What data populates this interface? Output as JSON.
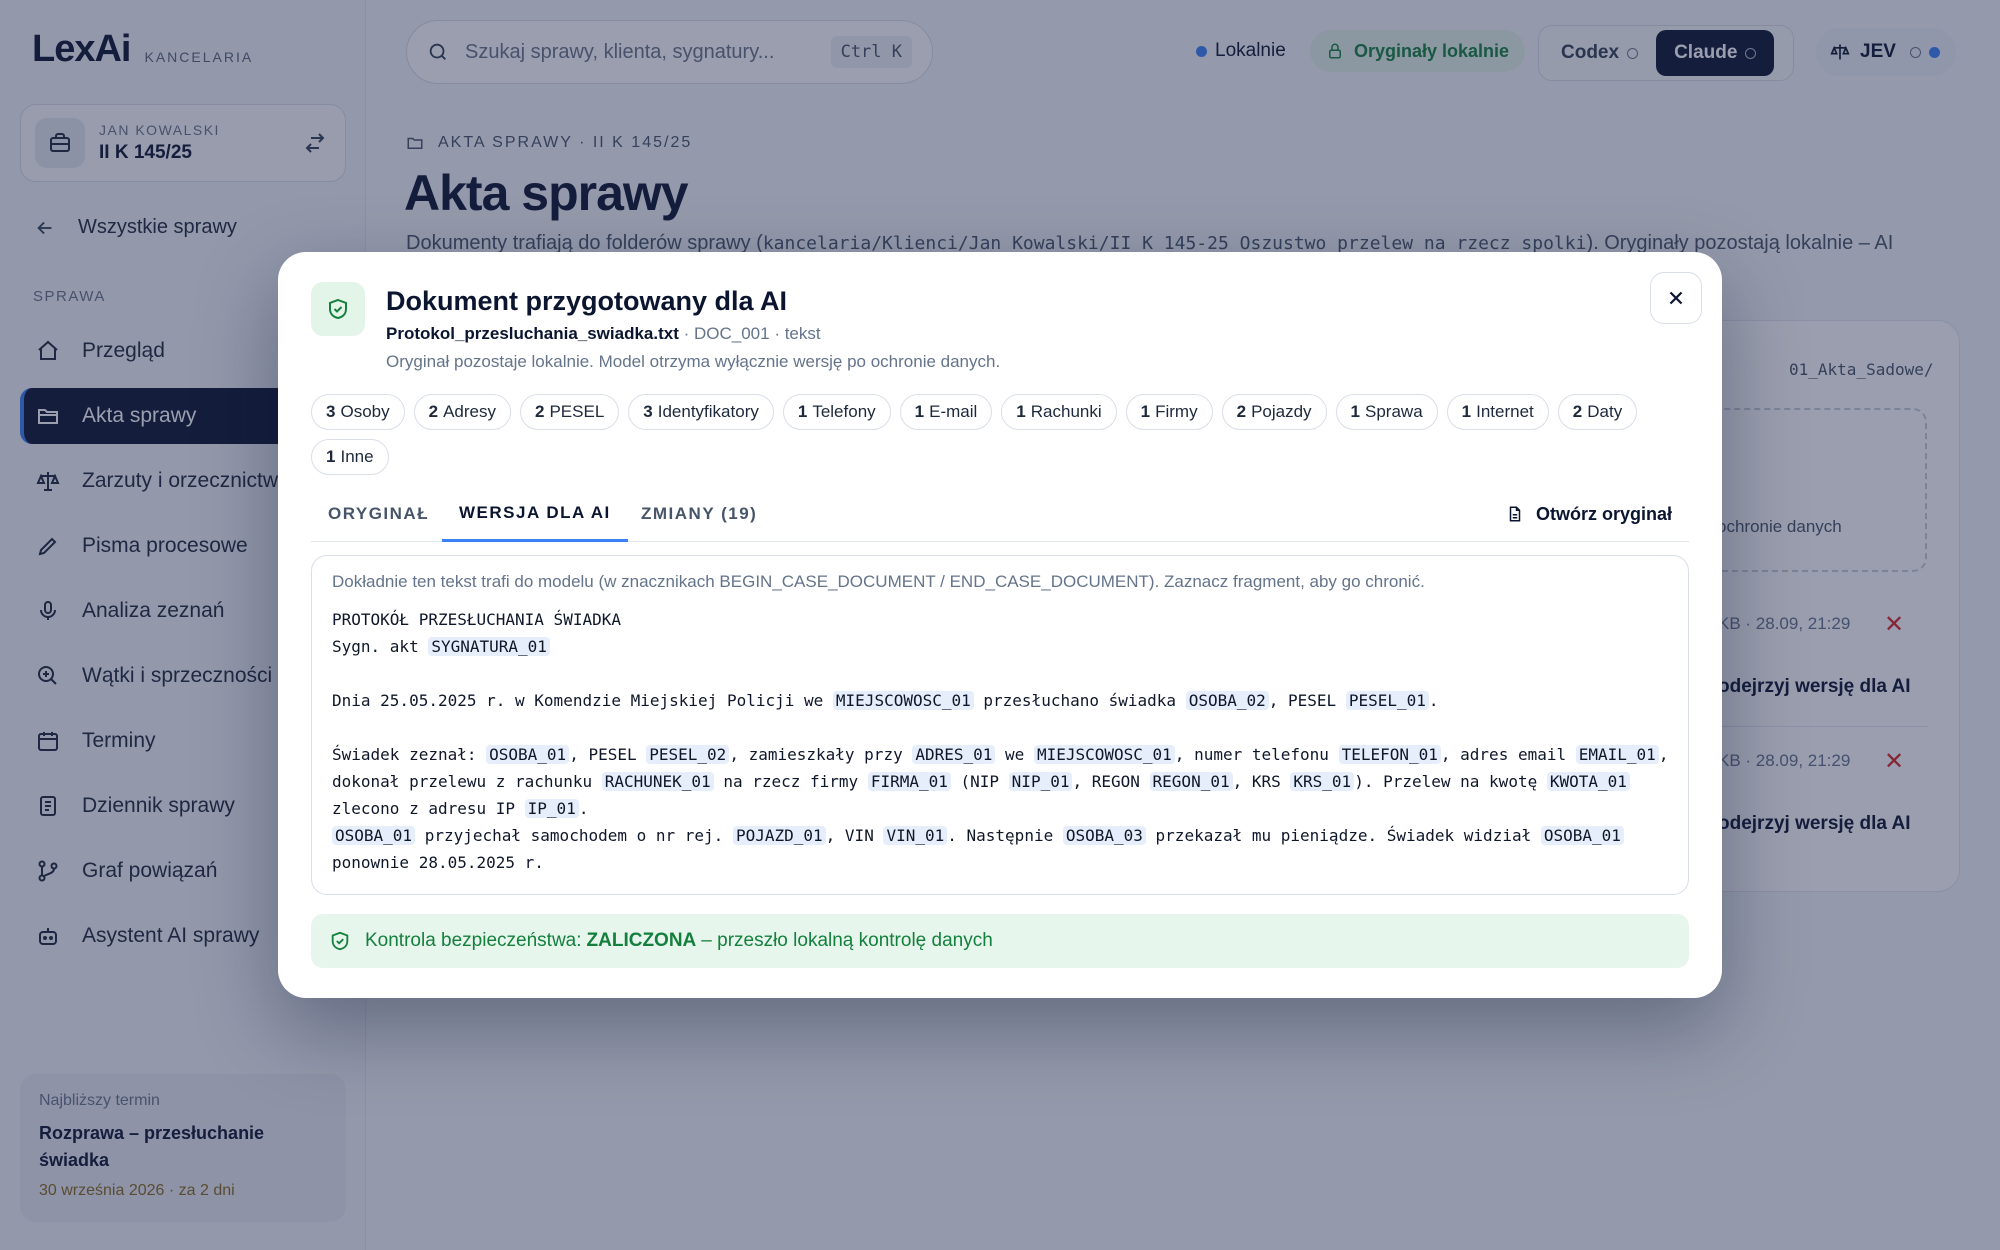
{
  "brand": {
    "logo": "LexAi",
    "subtitle": "KANCELARIA"
  },
  "case_card": {
    "client": "JAN KOWALSKI",
    "signature": "II K 145/25"
  },
  "back_link": "Wszystkie sprawy",
  "sidebar": {
    "section": "SPRAWA",
    "items": [
      {
        "label": "Przegląd",
        "icon": "home-icon"
      },
      {
        "label": "Akta sprawy",
        "icon": "folder-icon"
      },
      {
        "label": "Zarzuty i orzecznictwo",
        "icon": "scales-icon"
      },
      {
        "label": "Pisma procesowe",
        "icon": "pencil-icon"
      },
      {
        "label": "Analiza zeznań",
        "icon": "microphone-icon"
      },
      {
        "label": "Wątki i sprzeczności",
        "icon": "search-plus-icon"
      },
      {
        "label": "Terminy",
        "icon": "calendar-icon"
      },
      {
        "label": "Dziennik sprawy",
        "icon": "journal-icon"
      },
      {
        "label": "Graf powiązań",
        "icon": "graph-icon"
      },
      {
        "label": "Asystent AI sprawy",
        "icon": "robot-icon"
      }
    ],
    "active_index": 1
  },
  "next_term": {
    "label": "Najbliższy termin",
    "title": "Rozprawa – przesłuchanie świadka",
    "date": "30 września 2026 · za 2 dni"
  },
  "topbar": {
    "search_placeholder": "Szukaj sprawy, klienta, sygnatury...",
    "shortcut": "Ctrl K",
    "local": "Lokalnie",
    "originals": "Oryginały lokalnie",
    "models": [
      "Codex",
      "Claude"
    ],
    "active_model": "Claude",
    "user": "JEV"
  },
  "page": {
    "crumb": "AKTA SPRAWY · II K 145/25",
    "title": "Akta sprawy",
    "desc_prefix": "Dokumenty trafiają do folderów sprawy (",
    "desc_path": "kancelaria/Klienci/Jan Kowalski/II K 145-25 Oszustwo przelew na rzecz spolki",
    "desc_suffix": "). Oryginały pozostają lokalnie – AI"
  },
  "background_panel": {
    "path": "01_Akta_Sadowe/",
    "drop_text": "ochronie danych",
    "rows": [
      {
        "meta": "KB · 28.09, 21:29",
        "action": "odejrzyj wersję dla AI"
      },
      {
        "meta": "KB · 28.09, 21:29",
        "action": "odejrzyj wersję dla AI"
      }
    ]
  },
  "modal": {
    "title": "Dokument przygotowany dla AI",
    "file_name": "Protokol_przesluchania_swiadka.txt",
    "file_meta": " · DOC_001 · tekst",
    "note": "Oryginał pozostaje lokalnie. Model otrzyma wyłącznie wersję po ochronie danych.",
    "chips": [
      {
        "count": "3",
        "label": "Osoby"
      },
      {
        "count": "2",
        "label": "Adresy"
      },
      {
        "count": "2",
        "label": "PESEL"
      },
      {
        "count": "3",
        "label": "Identyfikatory"
      },
      {
        "count": "1",
        "label": "Telefony"
      },
      {
        "count": "1",
        "label": "E-mail"
      },
      {
        "count": "1",
        "label": "Rachunki"
      },
      {
        "count": "1",
        "label": "Firmy"
      },
      {
        "count": "2",
        "label": "Pojazdy"
      },
      {
        "count": "1",
        "label": "Sprawa"
      },
      {
        "count": "1",
        "label": "Internet"
      },
      {
        "count": "2",
        "label": "Daty"
      },
      {
        "count": "1",
        "label": "Inne"
      }
    ],
    "tabs": [
      "ORYGINAŁ",
      "WERSJA DLA AI",
      "ZMIANY (19)"
    ],
    "active_tab": 1,
    "open_original": "Otwórz oryginał",
    "hint": "Dokładnie ten tekst trafi do modelu (w znacznikach BEGIN_CASE_DOCUMENT / END_CASE_DOCUMENT). Zaznacz fragment, aby go chronić.",
    "doc_lines": [
      [
        {
          "t": "PROTOKÓŁ PRZESŁUCHANIA ŚWIADKA"
        }
      ],
      [
        {
          "t": "Sygn. akt "
        },
        {
          "k": "SYGNATURA_01"
        }
      ],
      [],
      [
        {
          "t": "Dnia 25.05.2025 r. w Komendzie Miejskiej Policji we "
        },
        {
          "k": "MIEJSCOWOSC_01"
        },
        {
          "t": " przesłuchano świadka "
        },
        {
          "k": "OSOBA_02"
        },
        {
          "t": ", PESEL "
        },
        {
          "k": "PESEL_01"
        },
        {
          "t": "."
        }
      ],
      [],
      [
        {
          "t": "Świadek zeznał: "
        },
        {
          "k": "OSOBA_01"
        },
        {
          "t": ", PESEL "
        },
        {
          "k": "PESEL_02"
        },
        {
          "t": ", zamieszkały przy "
        },
        {
          "k": "ADRES_01"
        },
        {
          "t": " we "
        },
        {
          "k": "MIEJSCOWOSC_01"
        },
        {
          "t": ", numer telefonu "
        },
        {
          "k": "TELEFON_01"
        },
        {
          "t": ", adres email "
        },
        {
          "k": "EMAIL_01"
        },
        {
          "t": ","
        }
      ],
      [
        {
          "t": "dokonał przelewu z rachunku "
        },
        {
          "k": "RACHUNEK_01"
        },
        {
          "t": " na rzecz firmy "
        },
        {
          "k": "FIRMA_01"
        },
        {
          "t": " (NIP "
        },
        {
          "k": "NIP_01"
        },
        {
          "t": ", REGON "
        },
        {
          "k": "REGON_01"
        },
        {
          "t": ", KRS "
        },
        {
          "k": "KRS_01"
        },
        {
          "t": "). Przelew na kwotę "
        },
        {
          "k": "KWOTA_01"
        }
      ],
      [
        {
          "t": "zlecono z adresu IP "
        },
        {
          "k": "IP_01"
        },
        {
          "t": "."
        }
      ],
      [
        {
          "k": "OSOBA_01"
        },
        {
          "t": " przyjechał samochodem o nr rej. "
        },
        {
          "k": "POJAZD_01"
        },
        {
          "t": ", VIN "
        },
        {
          "k": "VIN_01"
        },
        {
          "t": ". Następnie "
        },
        {
          "k": "OSOBA_03"
        },
        {
          "t": " przekazał mu pieniądze. Świadek widział "
        },
        {
          "k": "OSOBA_01"
        }
      ],
      [
        {
          "t": "ponownie 28.05.2025 r."
        }
      ]
    ],
    "safety_prefix": "Kontrola bezpieczeństwa:",
    "safety_status": "ZALICZONA",
    "safety_suffix": "– przeszło lokalną kontrolę danych"
  },
  "colors": {
    "navy": "#0b1530",
    "accent": "#3b82f6",
    "success": "#15803d",
    "danger": "#dc2626"
  }
}
